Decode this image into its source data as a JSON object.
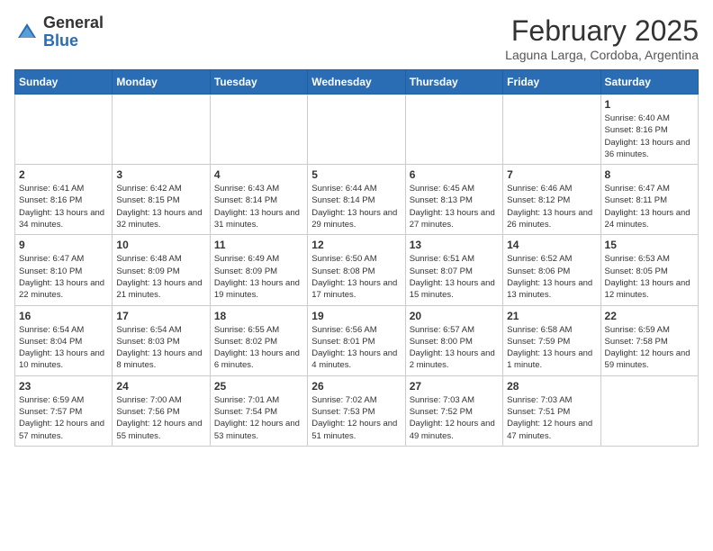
{
  "header": {
    "logo_general": "General",
    "logo_blue": "Blue",
    "title": "February 2025",
    "subtitle": "Laguna Larga, Cordoba, Argentina"
  },
  "days_of_week": [
    "Sunday",
    "Monday",
    "Tuesday",
    "Wednesday",
    "Thursday",
    "Friday",
    "Saturday"
  ],
  "weeks": [
    [
      {
        "day": "",
        "info": ""
      },
      {
        "day": "",
        "info": ""
      },
      {
        "day": "",
        "info": ""
      },
      {
        "day": "",
        "info": ""
      },
      {
        "day": "",
        "info": ""
      },
      {
        "day": "",
        "info": ""
      },
      {
        "day": "1",
        "info": "Sunrise: 6:40 AM\nSunset: 8:16 PM\nDaylight: 13 hours\nand 36 minutes."
      }
    ],
    [
      {
        "day": "2",
        "info": "Sunrise: 6:41 AM\nSunset: 8:16 PM\nDaylight: 13 hours\nand 34 minutes."
      },
      {
        "day": "3",
        "info": "Sunrise: 6:42 AM\nSunset: 8:15 PM\nDaylight: 13 hours\nand 32 minutes."
      },
      {
        "day": "4",
        "info": "Sunrise: 6:43 AM\nSunset: 8:14 PM\nDaylight: 13 hours\nand 31 minutes."
      },
      {
        "day": "5",
        "info": "Sunrise: 6:44 AM\nSunset: 8:14 PM\nDaylight: 13 hours\nand 29 minutes."
      },
      {
        "day": "6",
        "info": "Sunrise: 6:45 AM\nSunset: 8:13 PM\nDaylight: 13 hours\nand 27 minutes."
      },
      {
        "day": "7",
        "info": "Sunrise: 6:46 AM\nSunset: 8:12 PM\nDaylight: 13 hours\nand 26 minutes."
      },
      {
        "day": "8",
        "info": "Sunrise: 6:47 AM\nSunset: 8:11 PM\nDaylight: 13 hours\nand 24 minutes."
      }
    ],
    [
      {
        "day": "9",
        "info": "Sunrise: 6:47 AM\nSunset: 8:10 PM\nDaylight: 13 hours\nand 22 minutes."
      },
      {
        "day": "10",
        "info": "Sunrise: 6:48 AM\nSunset: 8:09 PM\nDaylight: 13 hours\nand 21 minutes."
      },
      {
        "day": "11",
        "info": "Sunrise: 6:49 AM\nSunset: 8:09 PM\nDaylight: 13 hours\nand 19 minutes."
      },
      {
        "day": "12",
        "info": "Sunrise: 6:50 AM\nSunset: 8:08 PM\nDaylight: 13 hours\nand 17 minutes."
      },
      {
        "day": "13",
        "info": "Sunrise: 6:51 AM\nSunset: 8:07 PM\nDaylight: 13 hours\nand 15 minutes."
      },
      {
        "day": "14",
        "info": "Sunrise: 6:52 AM\nSunset: 8:06 PM\nDaylight: 13 hours\nand 13 minutes."
      },
      {
        "day": "15",
        "info": "Sunrise: 6:53 AM\nSunset: 8:05 PM\nDaylight: 13 hours\nand 12 minutes."
      }
    ],
    [
      {
        "day": "16",
        "info": "Sunrise: 6:54 AM\nSunset: 8:04 PM\nDaylight: 13 hours\nand 10 minutes."
      },
      {
        "day": "17",
        "info": "Sunrise: 6:54 AM\nSunset: 8:03 PM\nDaylight: 13 hours\nand 8 minutes."
      },
      {
        "day": "18",
        "info": "Sunrise: 6:55 AM\nSunset: 8:02 PM\nDaylight: 13 hours\nand 6 minutes."
      },
      {
        "day": "19",
        "info": "Sunrise: 6:56 AM\nSunset: 8:01 PM\nDaylight: 13 hours\nand 4 minutes."
      },
      {
        "day": "20",
        "info": "Sunrise: 6:57 AM\nSunset: 8:00 PM\nDaylight: 13 hours\nand 2 minutes."
      },
      {
        "day": "21",
        "info": "Sunrise: 6:58 AM\nSunset: 7:59 PM\nDaylight: 13 hours\nand 1 minute."
      },
      {
        "day": "22",
        "info": "Sunrise: 6:59 AM\nSunset: 7:58 PM\nDaylight: 12 hours\nand 59 minutes."
      }
    ],
    [
      {
        "day": "23",
        "info": "Sunrise: 6:59 AM\nSunset: 7:57 PM\nDaylight: 12 hours\nand 57 minutes."
      },
      {
        "day": "24",
        "info": "Sunrise: 7:00 AM\nSunset: 7:56 PM\nDaylight: 12 hours\nand 55 minutes."
      },
      {
        "day": "25",
        "info": "Sunrise: 7:01 AM\nSunset: 7:54 PM\nDaylight: 12 hours\nand 53 minutes."
      },
      {
        "day": "26",
        "info": "Sunrise: 7:02 AM\nSunset: 7:53 PM\nDaylight: 12 hours\nand 51 minutes."
      },
      {
        "day": "27",
        "info": "Sunrise: 7:03 AM\nSunset: 7:52 PM\nDaylight: 12 hours\nand 49 minutes."
      },
      {
        "day": "28",
        "info": "Sunrise: 7:03 AM\nSunset: 7:51 PM\nDaylight: 12 hours\nand 47 minutes."
      },
      {
        "day": "",
        "info": ""
      }
    ]
  ]
}
